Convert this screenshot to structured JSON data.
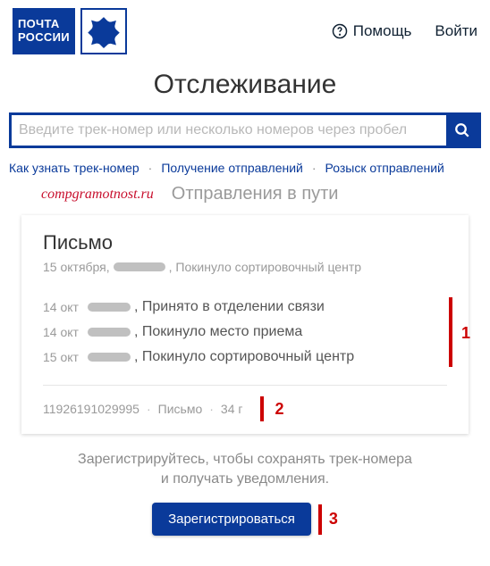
{
  "header": {
    "logo_line1": "ПОЧТА",
    "logo_line2": "РОССИИ",
    "help_label": "Помощь",
    "login_label": "Войти"
  },
  "page_title": "Отслеживание",
  "search": {
    "placeholder": "Введите трек-номер или несколько номеров через пробел"
  },
  "links": {
    "how": "Как узнать трек-номер",
    "receive": "Получение отправлений",
    "search_parcel": "Розыск отправлений"
  },
  "watermark": "compgramotnost.ru",
  "in_transit": "Отправления в пути",
  "card": {
    "title": "Письмо",
    "sub_date": "15 октября,",
    "sub_status": ", Покинуло сортировочный центр",
    "events": [
      {
        "date": "14 окт",
        "status": ", Принято в отделении связи"
      },
      {
        "date": "14 окт",
        "status": ", Покинуло место приема"
      },
      {
        "date": "15 окт",
        "status": ", Покинуло сортировочный центр"
      }
    ],
    "meta_track": "11926191029995",
    "meta_type": "Письмо",
    "meta_weight": "34 г"
  },
  "annotations": {
    "one": "1",
    "two": "2",
    "three": "3"
  },
  "cta": {
    "text_line1": "Зарегистрируйтесь, чтобы сохранять трек-номера",
    "text_line2": "и получать уведомления.",
    "button": "Зарегистрироваться"
  }
}
